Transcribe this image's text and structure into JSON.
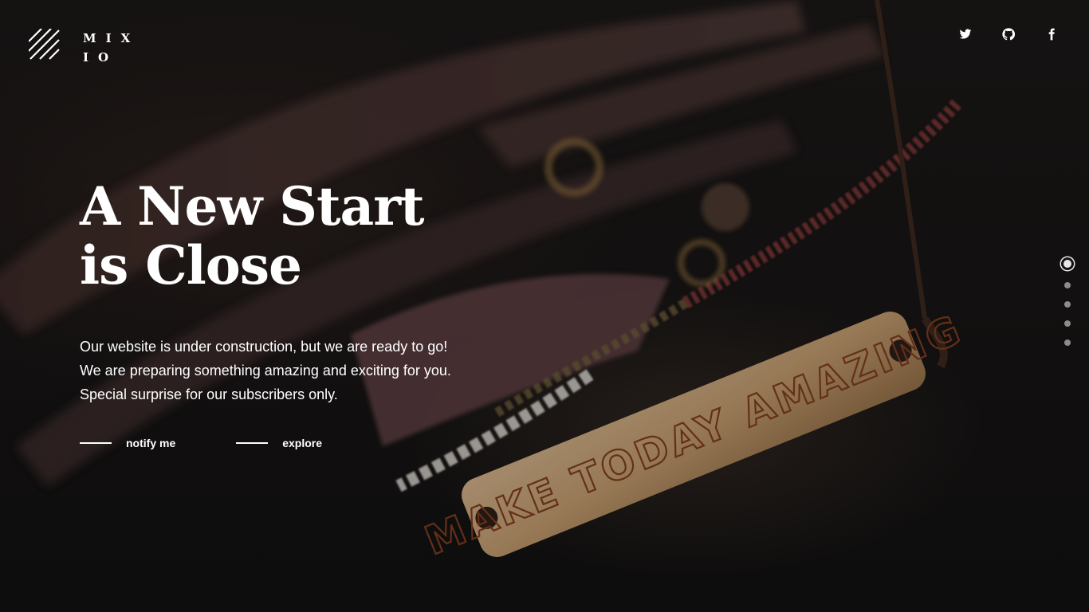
{
  "brand": {
    "logo_icon": "diagonal-stripes-icon",
    "line1": "MIX",
    "line2": "IO"
  },
  "social": [
    {
      "name": "twitter",
      "icon": "twitter-icon"
    },
    {
      "name": "github",
      "icon": "github-icon"
    },
    {
      "name": "facebook",
      "icon": "facebook-icon"
    }
  ],
  "hero": {
    "title_line1": "A New Start",
    "title_line2": "is Close",
    "description": "Our website is under construction, but we are ready to go! We are preparing something amazing and exciting for you. Special surprise for our subscribers only.",
    "actions": {
      "notify_label": "notify me",
      "explore_label": "explore"
    }
  },
  "background": {
    "photo_text": "MAKE TODAY AMAZING"
  },
  "slides": {
    "count": 5,
    "active_index": 0
  },
  "colors": {
    "text": "#ffffff",
    "background": "#141212",
    "dot_inactive": "#8c8c8c",
    "dot_active": "#e8e8e8"
  }
}
